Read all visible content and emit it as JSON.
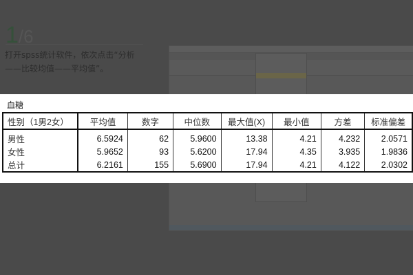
{
  "step": {
    "current": "1",
    "total": "/6",
    "text": "打开spss统计软件，依次点击“分析——比较均值——平均值”。"
  },
  "table": {
    "caption": "血糖",
    "headers": [
      "性别（1男2女）",
      "平均值",
      "数字",
      "中位数",
      "最大值(X)",
      "最小值",
      "方差",
      "标准偏差"
    ],
    "rows": [
      [
        "男性",
        "6.5924",
        "62",
        "5.9600",
        "13.38",
        "4.21",
        "4.232",
        "2.0571"
      ],
      [
        "女性",
        "5.9652",
        "93",
        "5.6200",
        "17.94",
        "4.35",
        "3.935",
        "1.9836"
      ],
      [
        "总计",
        "6.2161",
        "155",
        "5.6900",
        "17.94",
        "4.21",
        "4.122",
        "2.0302"
      ]
    ]
  }
}
